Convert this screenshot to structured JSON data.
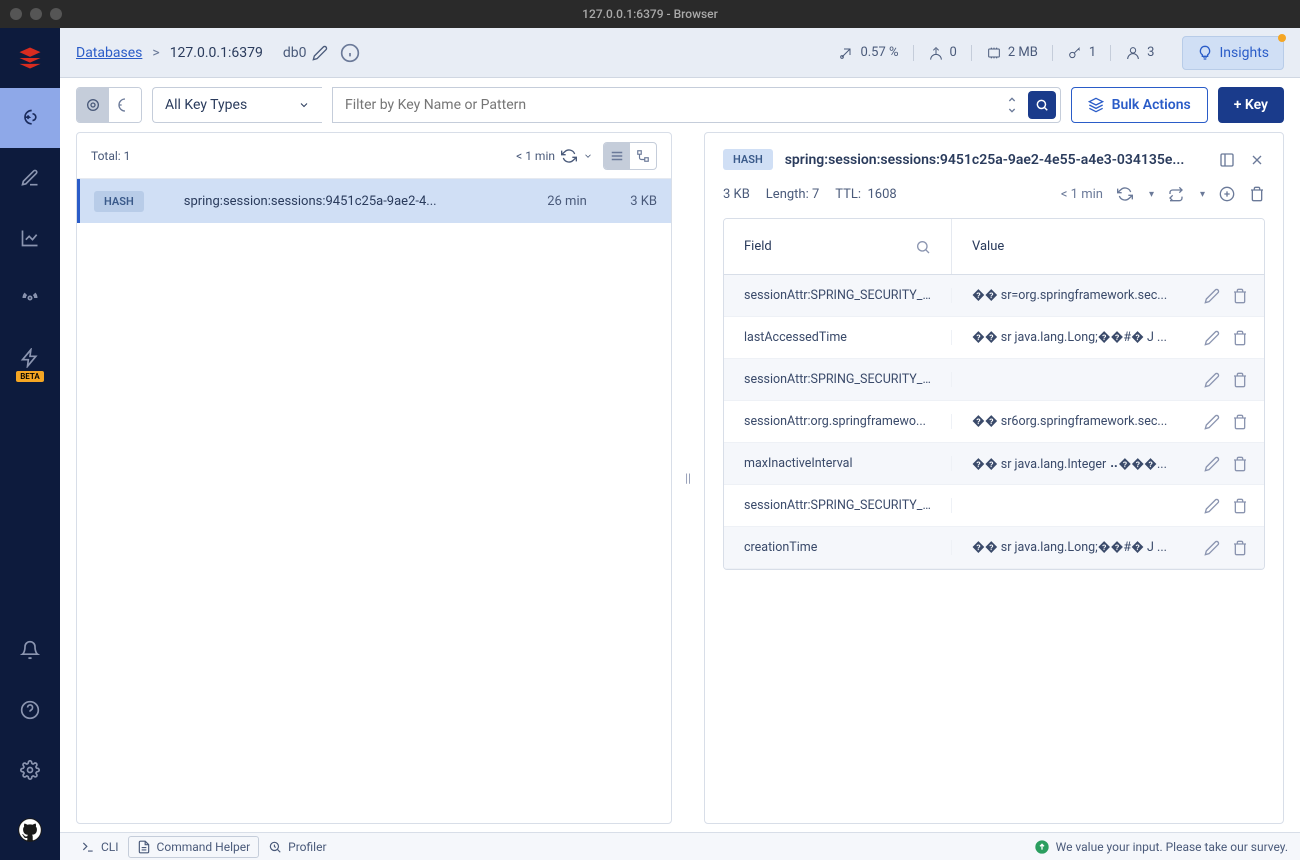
{
  "window": {
    "title": "127.0.0.1:6379 - Browser"
  },
  "breadcrumb": {
    "databases": "Databases",
    "host": "127.0.0.1:6379"
  },
  "db_selector": {
    "label": "db0"
  },
  "stats": {
    "cpu": "0.57 %",
    "ops": "0",
    "memory": "2 MB",
    "keys": "1",
    "clients": "3"
  },
  "insights": {
    "label": "Insights"
  },
  "toolbar": {
    "key_type_filter": "All Key Types",
    "filter_placeholder": "Filter by Key Name or Pattern",
    "bulk_label": "Bulk Actions",
    "add_key_label": "+ Key"
  },
  "keys_panel": {
    "total_label": "Total: 1",
    "refresh_label": "< 1 min"
  },
  "keys": [
    {
      "type": "HASH",
      "name": "spring:session:sessions:9451c25a-9ae2-4...",
      "ttl": "26 min",
      "size": "3 KB"
    }
  ],
  "details": {
    "type": "HASH",
    "name": "spring:session:sessions:9451c25a-9ae2-4e55-a4e3-034135e...",
    "size": "3 KB",
    "length_label": "Length: 7",
    "ttl_label": "TTL:",
    "ttl_value": "1608",
    "refresh_label": "< 1 min",
    "field_header": "Field",
    "value_header": "Value",
    "rows": [
      {
        "field": "sessionAttr:SPRING_SECURITY_...",
        "value": "�� sr=org.springframework.sec..."
      },
      {
        "field": "lastAccessedTime",
        "value": "�� sr java.lang.Long;��#�  J ..."
      },
      {
        "field": "sessionAttr:SPRING_SECURITY_...",
        "value": ""
      },
      {
        "field": "sessionAttr:org.springframewo...",
        "value": "�� sr6org.springframework.sec..."
      },
      {
        "field": "maxInactiveInterval",
        "value": "�� sr java.lang.Integer ⠤���..."
      },
      {
        "field": "sessionAttr:SPRING_SECURITY_...",
        "value": ""
      },
      {
        "field": "creationTime",
        "value": "�� sr java.lang.Long;��#�  J ..."
      }
    ]
  },
  "footer": {
    "cli": "CLI",
    "helper": "Command Helper",
    "profiler": "Profiler",
    "survey": "We value your input. Please take our survey."
  }
}
